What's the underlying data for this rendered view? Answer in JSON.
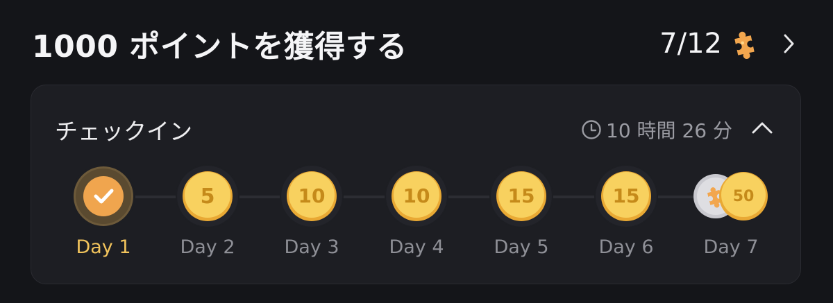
{
  "header": {
    "title": "1000 ポイントを獲得する",
    "progress": "7/12",
    "progress_icon": "puzzle-piece-icon",
    "nav_icon": "chevron-right-icon"
  },
  "checkin": {
    "title": "チェックイン",
    "timer": "10 時間 26 分",
    "timer_icon": "clock-icon",
    "collapse_icon": "chevron-up-icon",
    "days": [
      {
        "label": "Day 1",
        "reward": "",
        "claimed": true
      },
      {
        "label": "Day 2",
        "reward": "5",
        "claimed": false
      },
      {
        "label": "Day 3",
        "reward": "10",
        "claimed": false
      },
      {
        "label": "Day 4",
        "reward": "10",
        "claimed": false
      },
      {
        "label": "Day 5",
        "reward": "15",
        "claimed": false
      },
      {
        "label": "Day 6",
        "reward": "15",
        "claimed": false
      },
      {
        "label": "Day 7",
        "reward": "50",
        "claimed": false,
        "bonus_icon": "puzzle-piece-icon"
      }
    ]
  },
  "colors": {
    "background": "#141519",
    "card": "#1d1e23",
    "active_label": "#f2c45c",
    "coin": "#f7cf5a",
    "puzzle": "#f2a64e"
  }
}
